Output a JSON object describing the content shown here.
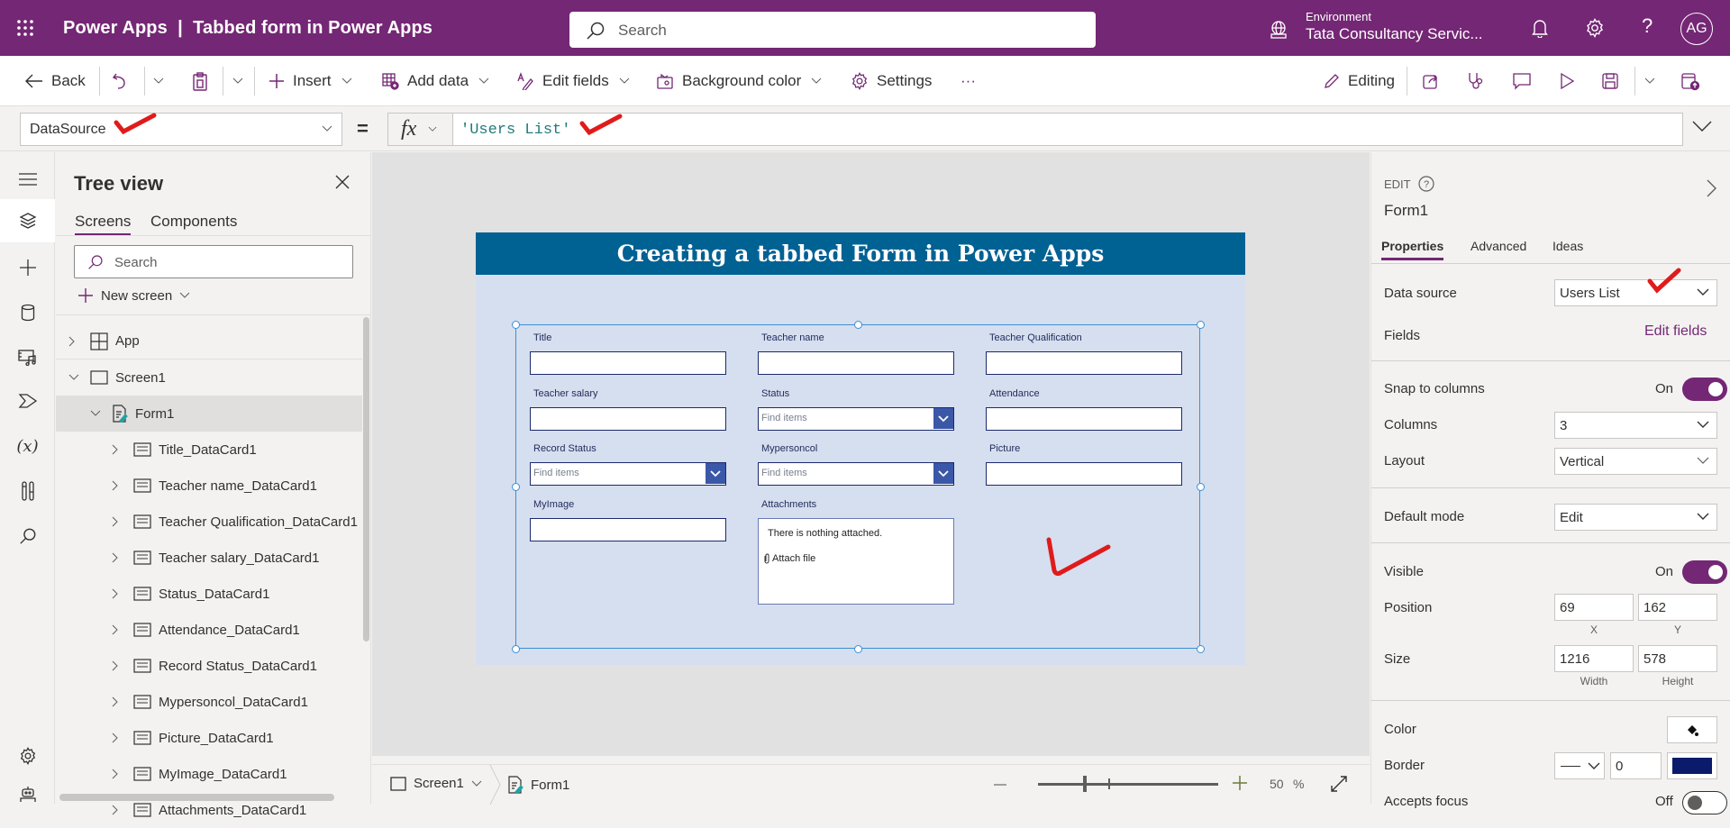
{
  "header": {
    "app_title": "Power Apps  |  Tabbed form in Power Apps",
    "search_placeholder": "Search",
    "environment_label": "Environment",
    "environment_name": "Tata Consultancy Servic...",
    "avatar_initials": "AG",
    "brand_color": "#742774"
  },
  "command_bar": {
    "back": "Back",
    "insert": "Insert",
    "add_data": "Add data",
    "edit_fields": "Edit fields",
    "background_color": "Background color",
    "settings": "Settings",
    "more": "···",
    "editing": "Editing"
  },
  "formula_bar": {
    "property": "DataSource",
    "equals": "=",
    "fx": "fx",
    "formula": "'Users List'"
  },
  "tree_view": {
    "title": "Tree view",
    "tabs": [
      "Screens",
      "Components"
    ],
    "active_tab": "Screens",
    "search_placeholder": "Search",
    "new_screen": "New screen",
    "nodes": [
      {
        "label": "App",
        "type": "app",
        "level": 0,
        "expanded": false
      },
      {
        "label": "Screen1",
        "type": "screen",
        "level": 0,
        "expanded": true
      },
      {
        "label": "Form1",
        "type": "form",
        "level": 1,
        "expanded": true,
        "selected": true
      },
      {
        "label": "Title_DataCard1",
        "type": "card",
        "level": 2
      },
      {
        "label": "Teacher name_DataCard1",
        "type": "card",
        "level": 2
      },
      {
        "label": "Teacher Qualification_DataCard1",
        "type": "card",
        "level": 2
      },
      {
        "label": "Teacher salary_DataCard1",
        "type": "card",
        "level": 2
      },
      {
        "label": "Status_DataCard1",
        "type": "card",
        "level": 2
      },
      {
        "label": "Attendance_DataCard1",
        "type": "card",
        "level": 2
      },
      {
        "label": "Record Status_DataCard1",
        "type": "card",
        "level": 2
      },
      {
        "label": "Mypersoncol_DataCard1",
        "type": "card",
        "level": 2
      },
      {
        "label": "Picture_DataCard1",
        "type": "card",
        "level": 2
      },
      {
        "label": "MyImage_DataCard1",
        "type": "card",
        "level": 2
      },
      {
        "label": "Attachments_DataCard1",
        "type": "card",
        "level": 2
      }
    ]
  },
  "canvas": {
    "screen_title": "Creating a tabbed Form in Power Apps",
    "header_color": "#006193",
    "screen_bg": "#d6dfef",
    "fields": [
      {
        "label": "Title",
        "kind": "text",
        "value": ""
      },
      {
        "label": "Teacher name",
        "kind": "text",
        "value": ""
      },
      {
        "label": "Teacher Qualification",
        "kind": "text",
        "value": ""
      },
      {
        "label": "Teacher salary",
        "kind": "text",
        "value": ""
      },
      {
        "label": "Status",
        "kind": "combo",
        "placeholder": "Find items"
      },
      {
        "label": "Attendance",
        "kind": "text",
        "value": ""
      },
      {
        "label": "Record Status",
        "kind": "combo",
        "placeholder": "Find items"
      },
      {
        "label": "Mypersoncol",
        "kind": "combo",
        "placeholder": "Find items"
      },
      {
        "label": "Picture",
        "kind": "text",
        "value": ""
      },
      {
        "label": "MyImage",
        "kind": "text",
        "value": ""
      },
      {
        "label": "Attachments",
        "kind": "attachments",
        "empty_message": "There is nothing attached.",
        "attach_label": "Attach file"
      }
    ]
  },
  "status_bar": {
    "screen": "Screen1",
    "control": "Form1",
    "zoom_percent": "50",
    "percent_sign": "%"
  },
  "properties_panel": {
    "kind_label": "EDIT",
    "control_name": "Form1",
    "tabs": [
      "Properties",
      "Advanced",
      "Ideas"
    ],
    "active_tab": "Properties",
    "data_source_label": "Data source",
    "data_source_value": "Users List",
    "fields_label": "Fields",
    "edit_fields_link": "Edit fields",
    "snap_label": "Snap to columns",
    "snap_state": "On",
    "columns_label": "Columns",
    "columns_value": "3",
    "layout_label": "Layout",
    "layout_value": "Vertical",
    "default_mode_label": "Default mode",
    "default_mode_value": "Edit",
    "visible_label": "Visible",
    "visible_state": "On",
    "position_label": "Position",
    "position_x": "69",
    "position_y": "162",
    "x_label": "X",
    "y_label": "Y",
    "size_label": "Size",
    "width": "1216",
    "height": "578",
    "width_label": "Width",
    "height_label": "Height",
    "color_label": "Color",
    "border_label": "Border",
    "border_width": "0",
    "border_color": "#0b1a6b",
    "accepts_focus_label": "Accepts focus",
    "accepts_focus_state": "Off"
  }
}
